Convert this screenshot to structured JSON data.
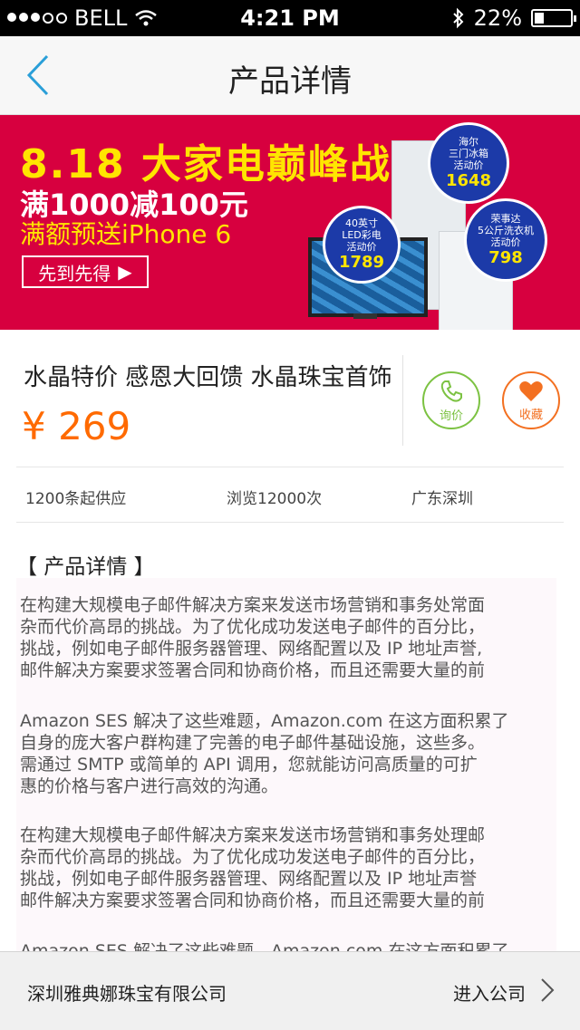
{
  "status_bar": {
    "carrier": "BELL",
    "time": "4:21 PM",
    "battery": "22%"
  },
  "navbar": {
    "title": "产品详情"
  },
  "banner": {
    "headline": "8.18 大家电巅峰战",
    "promo": "满1000减100元",
    "gift": "满额预送iPhone 6",
    "cta": "先到先得",
    "badges": [
      {
        "lines": [
          "海尔",
          "三门冰箱",
          "活动价"
        ],
        "price": "1648"
      },
      {
        "lines": [
          "40英寸",
          "LED彩电",
          "活动价"
        ],
        "price": "1789"
      },
      {
        "lines": [
          "荣事达",
          "5公斤洗衣机",
          "活动价"
        ],
        "price": "798"
      }
    ]
  },
  "product": {
    "title": "水晶特价 感恩大回馈 水晶珠宝首饰",
    "price": "¥ 269",
    "ask_label": "询价",
    "favorite_label": "收藏"
  },
  "info": {
    "supply": "1200条起供应",
    "views": "浏览12000次",
    "location": "广东深圳"
  },
  "detail": {
    "heading": "【 产品详情 】",
    "paragraphs": [
      [
        "在构建大规模电子邮件解决方案来发送市场营销和事务处常面",
        "杂而代价高昂的挑战。为了优化成功发送电子邮件的百分比，",
        "挑战，例如电子邮件服务器管理、网络配置以及 IP 地址声誉,",
        "邮件解决方案要求签署合同和协商价格，而且还需要大量的前"
      ],
      [
        "Amazon SES 解决了这些难题，Amazon.com 在这方面积累了",
        "自身的庞大客户群构建了完善的电子邮件基础设施，这些多。",
        "需通过 SMTP 或简单的 API 调用，您就能访问高质量的可扩",
        "惠的价格与客户进行高效的沟通。"
      ],
      [
        "在构建大规模电子邮件解决方案来发送市场营销和事务处理邮",
        "杂而代价高昂的挑战。为了优化成功发送电子邮件的百分比，",
        "挑战，例如电子邮件服务器管理、网络配置以及 IP 地址声誉",
        "邮件解决方案要求签署合同和协商价格，而且还需要大量的前"
      ],
      [
        "Amazon SES 解决了这些难题，Amazon.com 在这方面积累了"
      ]
    ]
  },
  "footer": {
    "company": "深圳雅典娜珠宝有限公司",
    "enter": "进入公司"
  },
  "colors": {
    "accent": "#ff6a00",
    "ask": "#7cc242",
    "favorite": "#f37021",
    "back": "#2a9fd8",
    "banner": "#d7003f"
  }
}
